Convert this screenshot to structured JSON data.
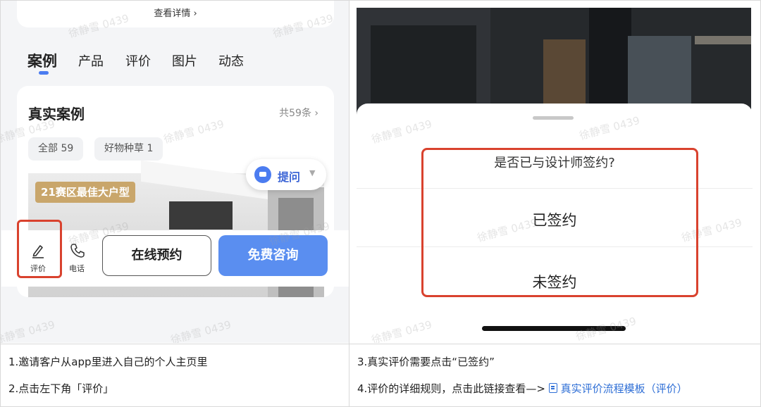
{
  "left_panel": {
    "top_link": "查看详情 ›",
    "tabs": [
      "案例",
      "产品",
      "评价",
      "图片",
      "动态"
    ],
    "case_section": {
      "title": "真实案例",
      "count": "共59条 ›",
      "chips": [
        "全部 59",
        "好物种草 1"
      ],
      "badge": "21赛区最佳大户型",
      "ask_button": "提问"
    },
    "bottom_bar": {
      "review_label": "评价",
      "phone_label": "电话",
      "book_button": "在线预约",
      "consult_button": "免费咨询"
    }
  },
  "right_panel": {
    "question": "是否已与设计师签约?",
    "option_signed": "已签约",
    "option_unsigned": "未签约"
  },
  "watermark": "徐静雪 0439",
  "captions": {
    "step1": "1.邀请客户从app里进入自己的个人主页里",
    "step2": "2.点击左下角「评价」",
    "step3": "3.真实评价需要点击“已签约”",
    "step4_prefix": "4.评价的详细规则，点击此链接查看—>",
    "step4_link": "真实评价流程模板（评价）"
  },
  "colors": {
    "accent_blue": "#5a8ef0",
    "highlight_red": "#d9422e",
    "badge_gold": "#c9a66b"
  }
}
